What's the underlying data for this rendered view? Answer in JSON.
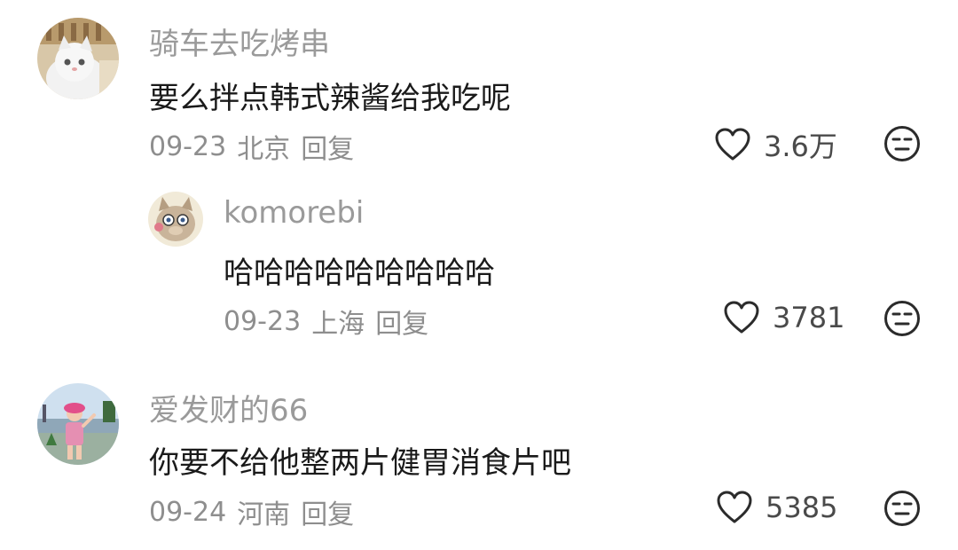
{
  "comments": [
    {
      "username": "骑车去吃烤串",
      "text": "要么拌点韩式辣酱给我吃呢",
      "date": "09-23",
      "location": "北京",
      "reply_label": "回复",
      "likes": "3.6万",
      "avatar_icon": "cat-avatar"
    },
    {
      "username": "komorebi",
      "text": "哈哈哈哈哈哈哈哈哈",
      "date": "09-23",
      "location": "上海",
      "reply_label": "回复",
      "likes": "3781",
      "avatar_icon": "cartoon-boar-avatar"
    },
    {
      "username": "爱发财的66",
      "text": "你要不给他整两片健胃消食片吧",
      "date": "09-24",
      "location": "河南",
      "reply_label": "回复",
      "likes": "5385",
      "avatar_icon": "girl-photo-avatar"
    }
  ],
  "icons": {
    "like": "heart-outline-icon",
    "dislike": "meh-face-icon"
  },
  "colors": {
    "username": "#9a9a9a",
    "text": "#1a1a1a",
    "meta": "#8e8e8e",
    "icon": "#2b2b2b"
  }
}
